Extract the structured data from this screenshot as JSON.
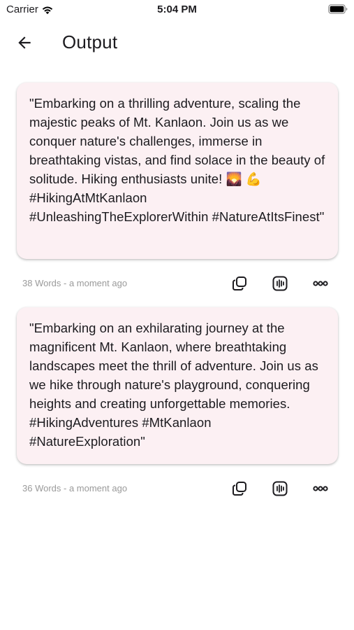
{
  "status_bar": {
    "carrier": "Carrier",
    "time": "5:04 PM",
    "icons": [
      "wifi-icon",
      "battery-icon"
    ]
  },
  "app_bar": {
    "title": "Output",
    "back_icon": "arrow-left-icon"
  },
  "results": [
    {
      "text": "\"Embarking on a thrilling adventure, scaling the majestic peaks of Mt. Kanlaon. Join us as we conquer nature's challenges, immerse in breathtaking vistas, and find solace in the beauty of solitude. Hiking enthusiasts unite! 🌄 💪 #HikingAtMtKanlaon #UnleashingTheExplorerWithin #NatureAtItsFinest\"",
      "meta": "38 Words - a moment ago"
    },
    {
      "text": "\"Embarking on an exhilarating journey at the magnificent Mt. Kanlaon, where breathtaking landscapes meet the thrill of adventure. Join us as we hike through nature's playground, conquering heights and creating unforgettable memories. #HikingAdventures #MtKanlaon #NatureExploration\"",
      "meta": "36 Words - a moment ago"
    }
  ],
  "actions": [
    "copy-icon",
    "audio-icon",
    "more-icon"
  ],
  "colors": {
    "card_background": "#fcf0f3",
    "meta_text": "#9a9a9a",
    "text": "#1c1b1f"
  }
}
